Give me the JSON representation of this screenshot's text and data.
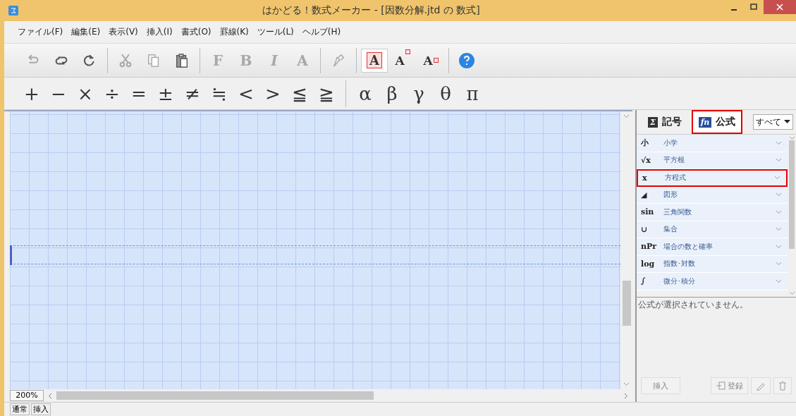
{
  "window": {
    "title": "はかどる！数式メーカー - [因数分解.jtd の 数式]"
  },
  "menu": [
    "ファイル(F)",
    "編集(E)",
    "表示(V)",
    "挿入(I)",
    "書式(O)",
    "罫線(K)",
    "ツール(L)",
    "ヘルプ(H)"
  ],
  "toolbar": [
    [
      {
        "kind": "undo",
        "disabled": true,
        "pressed": false
      },
      {
        "kind": "repeat",
        "disabled": false,
        "pressed": false
      },
      {
        "kind": "redo",
        "disabled": false,
        "pressed": false
      }
    ],
    [
      {
        "kind": "cut",
        "disabled": true,
        "pressed": false
      },
      {
        "kind": "copy",
        "disabled": true,
        "pressed": false
      },
      {
        "kind": "paste",
        "disabled": false,
        "pressed": false
      }
    ],
    [
      {
        "kind": "text",
        "label": "F",
        "disabled": true,
        "pressed": false
      },
      {
        "kind": "text",
        "label": "B",
        "disabled": true,
        "pressed": false
      },
      {
        "kind": "text",
        "label": "I",
        "italic": true,
        "disabled": true,
        "pressed": false
      },
      {
        "kind": "text",
        "label": "A",
        "disabled": true,
        "pressed": false
      }
    ],
    [
      {
        "kind": "brush",
        "disabled": true,
        "pressed": false
      }
    ],
    [
      {
        "kind": "boxed",
        "label": "A",
        "disabled": false,
        "pressed": true
      },
      {
        "kind": "super",
        "label": "A",
        "disabled": false,
        "pressed": false
      },
      {
        "kind": "sub",
        "label": "A",
        "disabled": false,
        "pressed": false
      }
    ],
    [
      {
        "kind": "help",
        "disabled": false,
        "pressed": false
      }
    ]
  ],
  "symbols": [
    [
      "+",
      "−",
      "×",
      "÷",
      "=",
      "±",
      "≠",
      "≒",
      "<",
      ">",
      "≦",
      "≧"
    ],
    [
      "α",
      "β",
      "γ",
      "θ",
      "π"
    ]
  ],
  "editor": {
    "zoom": "200%"
  },
  "panel": {
    "tabs": [
      {
        "label": "記号",
        "glyph": "Σ",
        "selected": false,
        "highlighted": false
      },
      {
        "label": "公式",
        "glyph": "fn",
        "selected": true,
        "highlighted": true
      }
    ],
    "filter": "すべて",
    "categories": [
      {
        "glyph": "小",
        "label": "小学",
        "highlighted": false
      },
      {
        "glyph": "√x",
        "label": "平方根",
        "highlighted": false
      },
      {
        "glyph": "x",
        "label": "方程式",
        "highlighted": true
      },
      {
        "glyph": "◢",
        "label": "図形",
        "highlighted": false
      },
      {
        "glyph": "sin",
        "label": "三角関数",
        "highlighted": false
      },
      {
        "glyph": "∪",
        "label": "集合",
        "highlighted": false
      },
      {
        "glyph": "nPr",
        "label": "場合の数と確率",
        "highlighted": false
      },
      {
        "glyph": "log",
        "label": "指数･対数",
        "highlighted": false
      },
      {
        "glyph": "∫",
        "label": "微分･積分",
        "highlighted": false
      }
    ],
    "message": "公式が選択されていません。",
    "insert_button": "挿入",
    "register_button": "登録"
  },
  "status_bar": [
    "通常",
    "挿入"
  ]
}
